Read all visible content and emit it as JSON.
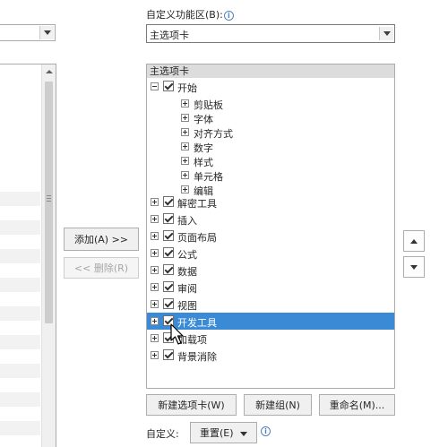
{
  "header": {
    "customize_ribbon_label": "自定义功能区(B):",
    "info_glyph": "i"
  },
  "ribbon_dropdown": {
    "value": "主选项卡"
  },
  "buttons": {
    "add": "添加(A) >>",
    "remove": "<< 删除(R)",
    "new_tab": "新建选项卡(W)",
    "new_group": "新建组(N)",
    "rename": "重命名(M)...",
    "reset": "重置(E)"
  },
  "custom_label": "自定义:",
  "tree": {
    "header": "主选项卡",
    "items": [
      {
        "label": "开始"
      },
      {
        "label": "剪贴板"
      },
      {
        "label": "字体"
      },
      {
        "label": "对齐方式"
      },
      {
        "label": "数字"
      },
      {
        "label": "样式"
      },
      {
        "label": "单元格"
      },
      {
        "label": "编辑"
      },
      {
        "label": "解密工具"
      },
      {
        "label": "插入"
      },
      {
        "label": "页面布局"
      },
      {
        "label": "公式"
      },
      {
        "label": "数据"
      },
      {
        "label": "审阅"
      },
      {
        "label": "视图"
      },
      {
        "label": "开发工具"
      },
      {
        "label": "加载项"
      },
      {
        "label": "背景消除"
      }
    ]
  },
  "colors": {
    "selection": "#3a8ad6",
    "info_blue": "#4f81bd"
  }
}
